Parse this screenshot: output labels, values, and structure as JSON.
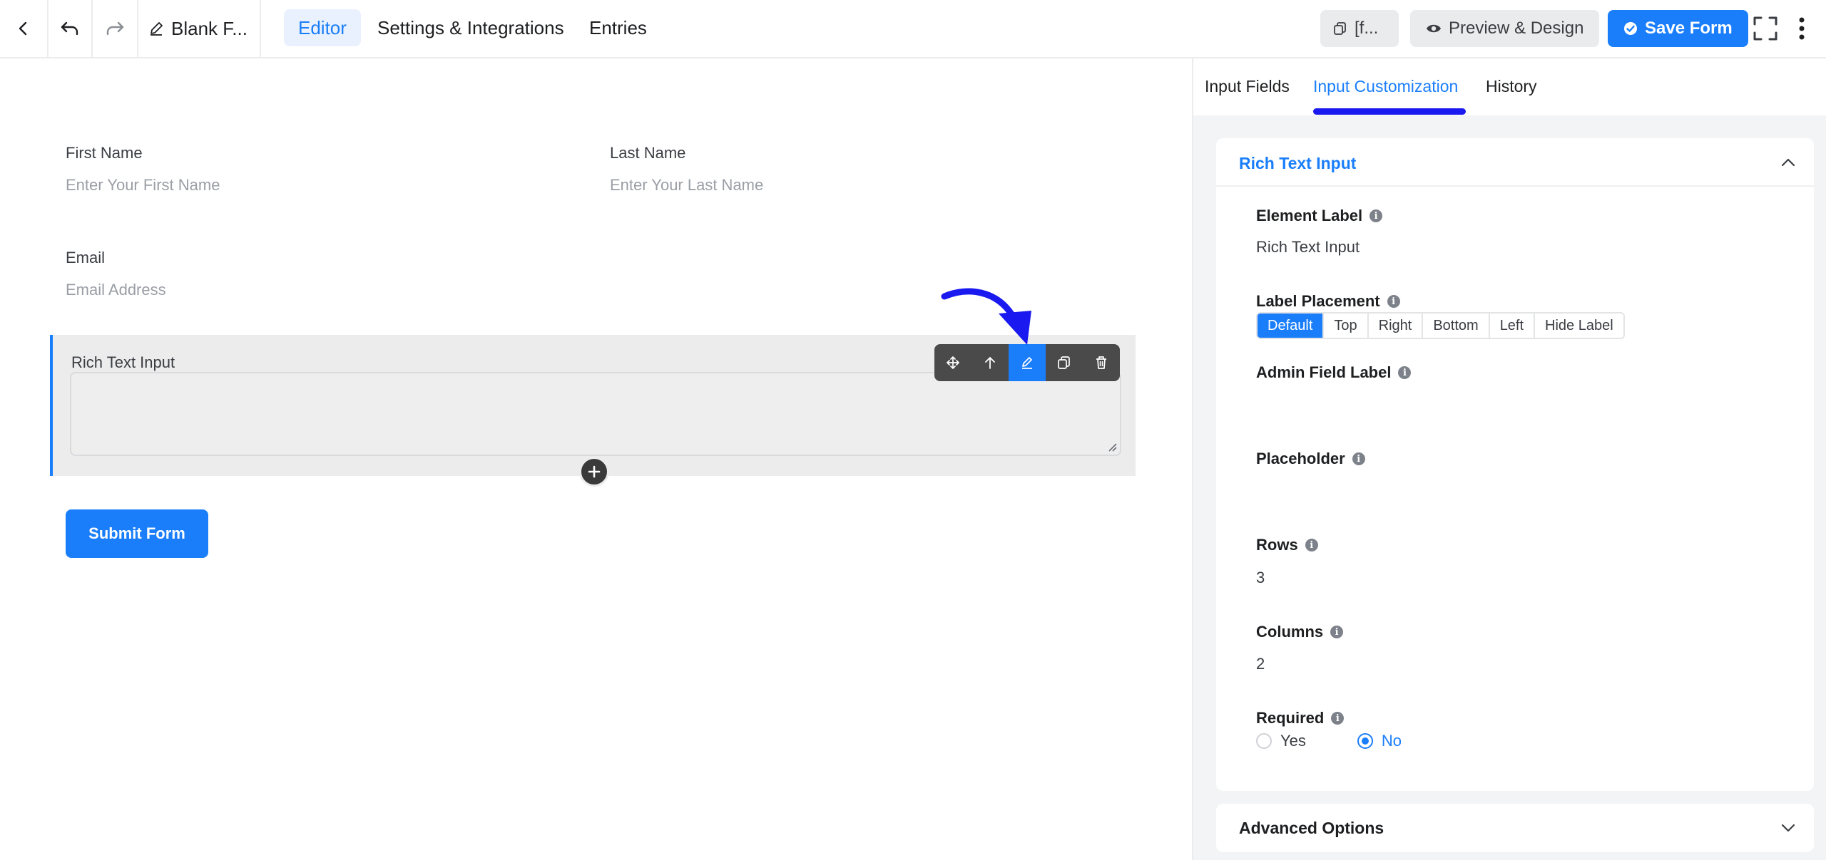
{
  "topbar": {
    "form_name": "Blank F...",
    "nav_tabs": [
      {
        "label": "Editor",
        "active": true
      },
      {
        "label": "Settings & Integrations",
        "active": false
      },
      {
        "label": "Entries",
        "active": false
      }
    ],
    "shortcode_label": "[f...",
    "preview_label": "Preview & Design",
    "save_label": "Save Form"
  },
  "form": {
    "first_name": {
      "label": "First Name",
      "placeholder": "Enter Your First Name"
    },
    "last_name": {
      "label": "Last Name",
      "placeholder": "Enter Your Last Name"
    },
    "email": {
      "label": "Email",
      "placeholder": "Email Address"
    },
    "rich_text": {
      "label": "Rich Text Input"
    },
    "submit_label": "Submit Form"
  },
  "field_toolbar": {
    "icons": [
      "move-icon",
      "arrow-up-icon",
      "edit-icon",
      "duplicate-icon",
      "trash-icon"
    ],
    "active_icon": "edit-icon"
  },
  "sidebar": {
    "tabs": [
      {
        "label": "Input Fields",
        "active": false
      },
      {
        "label": "Input Customization",
        "active": true
      },
      {
        "label": "History",
        "active": false
      }
    ],
    "panel_title": "Rich Text Input",
    "element_label": {
      "label": "Element Label",
      "value": "Rich Text Input"
    },
    "label_placement": {
      "label": "Label Placement",
      "options": [
        "Default",
        "Top",
        "Right",
        "Bottom",
        "Left",
        "Hide Label"
      ],
      "selected": "Default"
    },
    "admin_field_label": {
      "label": "Admin Field Label",
      "value": ""
    },
    "placeholder": {
      "label": "Placeholder",
      "value": ""
    },
    "rows": {
      "label": "Rows",
      "value": "3"
    },
    "columns": {
      "label": "Columns",
      "value": "2"
    },
    "required": {
      "label": "Required",
      "options": [
        "Yes",
        "No"
      ],
      "selected": "No"
    },
    "advanced_options": "Advanced Options"
  },
  "colors": {
    "accent": "#1a7efb",
    "annotation_arrow": "#1a1af0",
    "toolbar_bg": "#4a4a4a"
  }
}
